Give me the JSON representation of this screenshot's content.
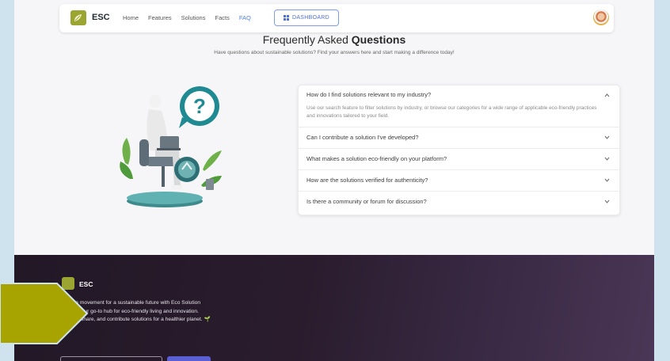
{
  "nav": {
    "brand": "ESC",
    "links": [
      "Home",
      "Features",
      "Solutions",
      "Facts",
      "FAQ"
    ],
    "active": "FAQ",
    "dashboard_label": "DASHBOARD"
  },
  "heading": {
    "title_plain": "Frequently Asked ",
    "title_bold": "Questions",
    "subtitle": "Have questions about sustainable solutions? Find your answers here and start making a difference today!"
  },
  "faq": [
    {
      "question": "How do I find solutions relevant to my industry?",
      "answer": "Use our search feature to filter solutions by industry, or browse our categories for a wide range of applicable eco-friendly practices and innovations tailored to your field.",
      "open": true
    },
    {
      "question": "Can I contribute a solution I've developed?",
      "open": false
    },
    {
      "question": "What makes a solution eco-friendly on your platform?",
      "open": false
    },
    {
      "question": "How are the solutions verified for authenticity?",
      "open": false
    },
    {
      "question": "Is there a community or forum for discussion?",
      "open": false
    }
  ],
  "footer": {
    "brand": "ESC",
    "description": "Join the movement for a sustainable future with Eco Solution Corner, your go-to hub for eco-friendly living and innovation. Explore, share, and contribute solutions for a healthier planet. 🌱"
  },
  "colors": {
    "brand_green": "#9aa631",
    "accent_blue": "#4f7fe8",
    "footer_bg": "#221826",
    "overlay_arrow": "#a7a300"
  }
}
